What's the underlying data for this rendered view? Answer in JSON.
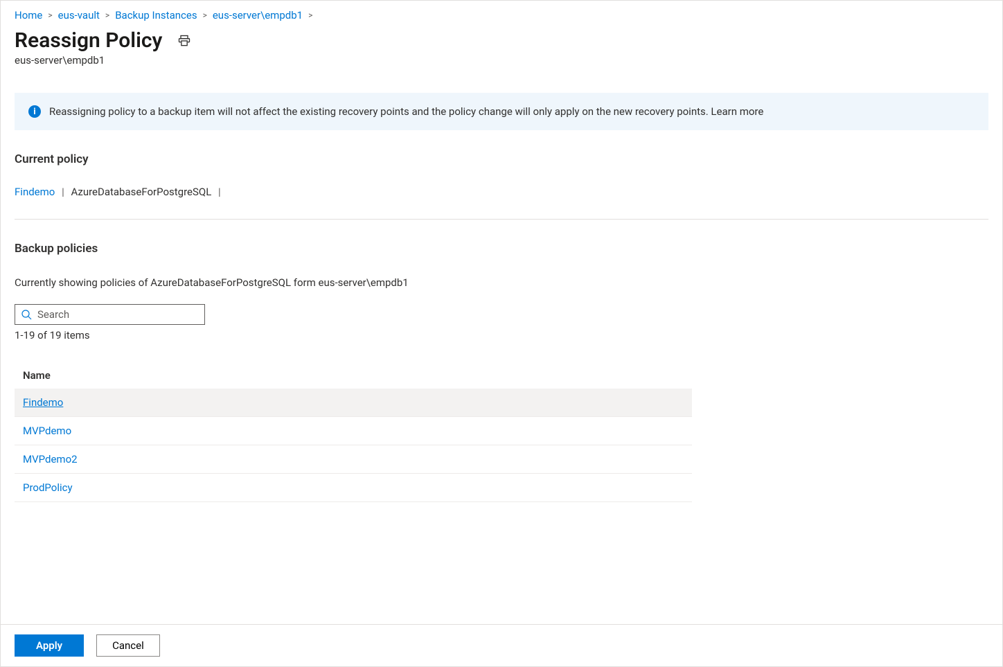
{
  "breadcrumb": [
    {
      "label": "Home"
    },
    {
      "label": "eus-vault"
    },
    {
      "label": "Backup Instances"
    },
    {
      "label": "eus-server\\empdb1"
    }
  ],
  "page_title": "Reassign Policy",
  "subtitle": "eus-server\\empdb1",
  "info_text": "Reassigning policy to a backup item will not affect the existing recovery points and the policy change will only apply on the new recovery points. Learn more",
  "current_policy_heading": "Current policy",
  "current_policy": {
    "name": "Findemo",
    "type": "AzureDatabaseForPostgreSQL"
  },
  "backup_policies_heading": "Backup policies",
  "backup_policies_desc": "Currently showing policies of AzureDatabaseForPostgreSQL form eus-server\\empdb1",
  "search_placeholder": "Search",
  "result_count": "1-19 of 19 items",
  "table_header": "Name",
  "policies": [
    {
      "name": "Findemo",
      "selected": true
    },
    {
      "name": "MVPdemo",
      "selected": false
    },
    {
      "name": "MVPdemo2",
      "selected": false
    },
    {
      "name": "ProdPolicy",
      "selected": false
    }
  ],
  "buttons": {
    "apply": "Apply",
    "cancel": "Cancel"
  }
}
